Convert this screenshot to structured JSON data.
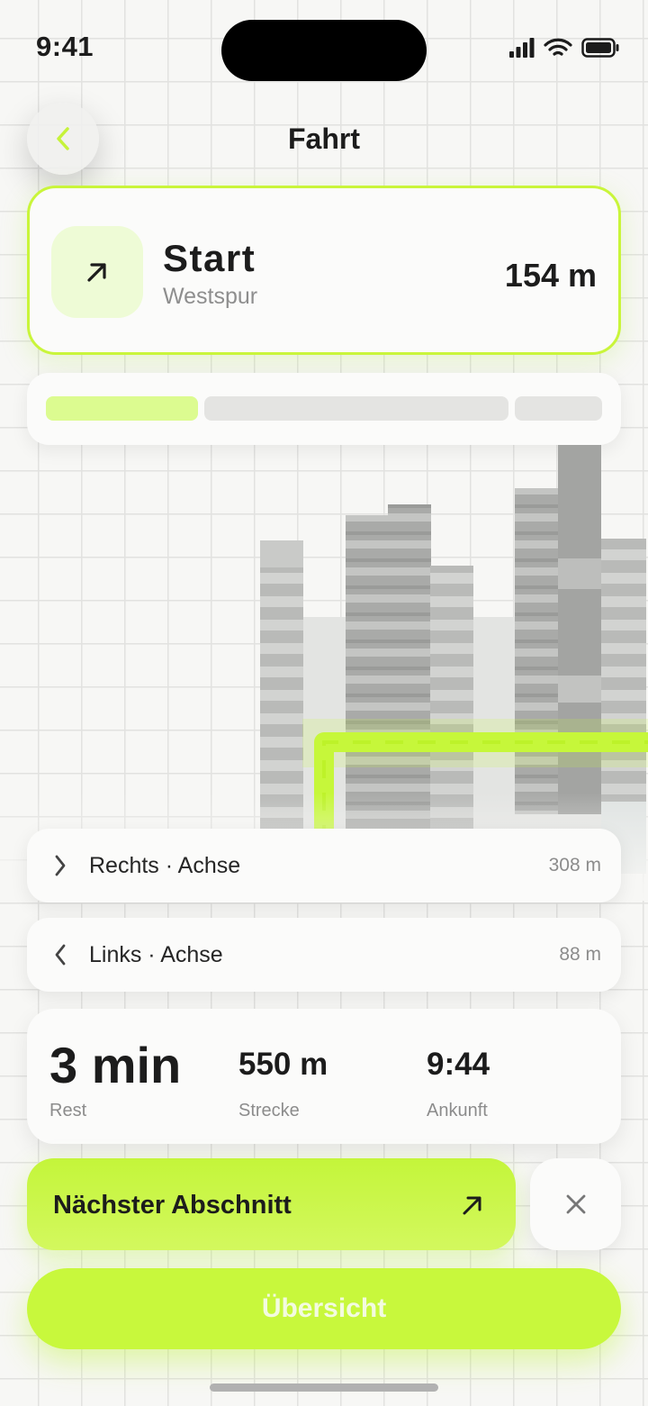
{
  "status_bar": {
    "time": "9:41",
    "icons": [
      "cellular-signal-icon",
      "wifi-icon",
      "battery-icon"
    ]
  },
  "header": {
    "title": "Fahrt",
    "back_icon": "chevron-left-icon"
  },
  "current_step": {
    "icon": "arrow-up-right-icon",
    "title": "Start",
    "subtitle": "Westspur",
    "distance": "154 m"
  },
  "progress": {
    "segments": [
      "done",
      "pending",
      "pending"
    ]
  },
  "upcoming_steps": [
    {
      "icon": "chevron-right-icon",
      "label": "Rechts · Achse",
      "distance": "308 m"
    },
    {
      "icon": "chevron-left-icon",
      "label": "Links · Achse",
      "distance": "88 m"
    }
  ],
  "stats": {
    "remaining": {
      "value": "3 min",
      "label": "Rest"
    },
    "distance": {
      "value": "550 m",
      "label": "Strecke"
    },
    "arrival": {
      "value": "9:44",
      "label": "Ankunft"
    }
  },
  "actions": {
    "next_label": "Nächster Abschnitt",
    "next_icon": "arrow-up-right-icon",
    "close_icon": "close-icon",
    "overview_label": "Übersicht"
  },
  "colors": {
    "accent": "#c8f83c",
    "background": "#f7f7f5",
    "text": "#1c1c1c",
    "muted": "#8c8c8c"
  }
}
